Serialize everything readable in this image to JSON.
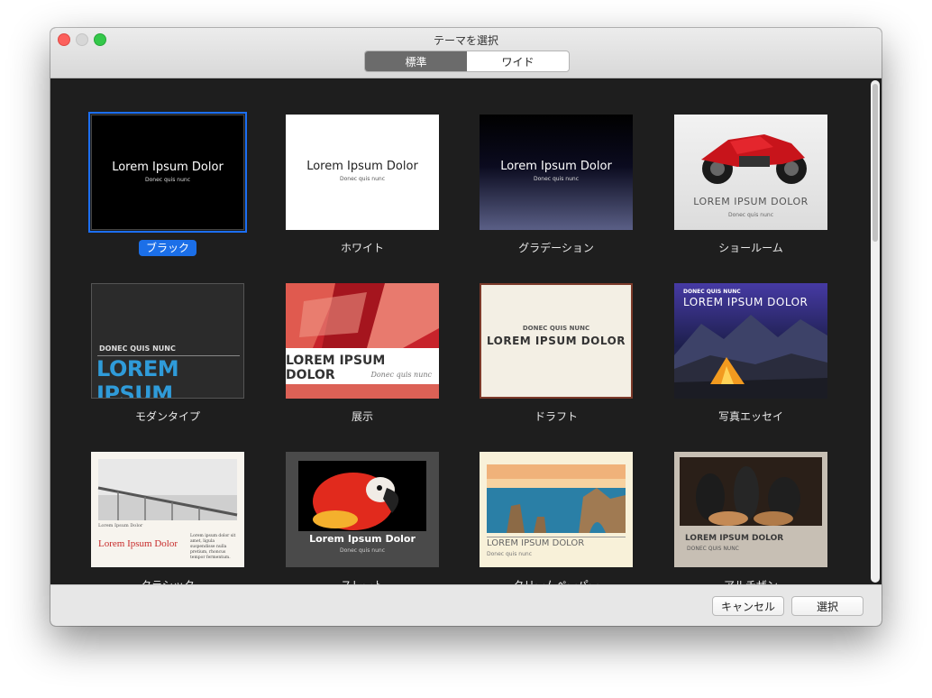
{
  "window": {
    "title": "テーマを選択"
  },
  "tabs": [
    {
      "label": "標準",
      "active": true
    },
    {
      "label": "ワイド",
      "active": false
    }
  ],
  "themes": [
    {
      "name": "ブラック",
      "title": "Lorem Ipsum Dolor",
      "subtitle": "Donec quis nunc",
      "selected": true
    },
    {
      "name": "ホワイト",
      "title": "Lorem Ipsum Dolor",
      "subtitle": "Donec quis nunc"
    },
    {
      "name": "グラデーション",
      "title": "Lorem Ipsum Dolor",
      "subtitle": "Donec quis nunc"
    },
    {
      "name": "ショールーム",
      "title": "LOREM IPSUM DOLOR",
      "subtitle": "Donec quis nunc"
    },
    {
      "name": "モダンタイプ",
      "title": "LOREM IPSUM",
      "subtitle": "DONEC QUIS NUNC"
    },
    {
      "name": "展示",
      "title": "LOREM IPSUM DOLOR",
      "subtitle": "Donec quis nunc"
    },
    {
      "name": "ドラフト",
      "title": "LOREM IPSUM DOLOR",
      "subtitle": "DONEC QUIS NUNC"
    },
    {
      "name": "写真エッセイ",
      "title": "LOREM IPSUM DOLOR",
      "subtitle": "DONEC QUIS NUNC"
    },
    {
      "name": "クラシック",
      "title": "Lorem Ipsum Dolor",
      "subtitle": "Lorem Ipsum Dolor",
      "body": "Lorem ipsum dolor sit amet, ligula suspendisse nulla pretium, rhoncus tempor fermentum."
    },
    {
      "name": "スレート",
      "title": "Lorem Ipsum Dolor",
      "subtitle": "Donec quis nunc"
    },
    {
      "name": "クリームペーパー",
      "title": "LOREM IPSUM DOLOR",
      "subtitle": "Donec quis nunc"
    },
    {
      "name": "アルチザン",
      "title": "LOREM IPSUM DOLOR",
      "subtitle": "DONEC QUIS NUNC"
    }
  ],
  "buttons": {
    "cancel": "キャンセル",
    "choose": "選択"
  },
  "colors": {
    "accent": "#1b6fe8",
    "content_bg": "#1e1e1e",
    "modern_blue": "#2f9bd9",
    "exhibit_red": "#d33a2c"
  }
}
